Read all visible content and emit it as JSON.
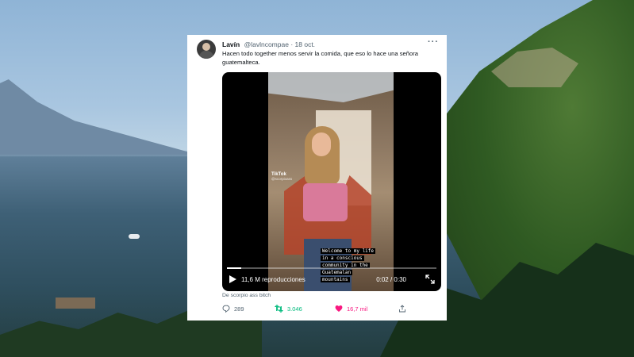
{
  "tweet": {
    "display_name": "Lavín",
    "handle": "@lavlncompae",
    "separator": "·",
    "date": "18 oct.",
    "more": "···",
    "text": "Hacen todo together menos servir la comida, que eso lo hace una señora guatemalteca.",
    "video": {
      "tiktok_label": "TikTok",
      "tiktok_user": "@scorpioass",
      "caption_lines": [
        "Welcome to my life",
        "in a conscious",
        "community in the",
        "Guatemalan",
        "mountains"
      ],
      "views": "11,6 M reproducciones",
      "time": "0:02 / 0:30",
      "progress": 0.067
    },
    "from": "De scorpio ass bitch",
    "actions": {
      "replies": "289",
      "retweets": "3.046",
      "likes": "16,7 mil"
    },
    "colors": {
      "retweet": "#00ba7c",
      "like": "#f91880",
      "muted": "#536471"
    }
  }
}
